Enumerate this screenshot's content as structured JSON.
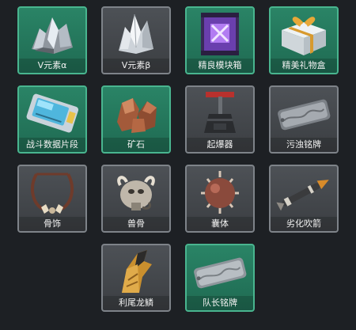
{
  "items": [
    {
      "label": "V元素α",
      "rarity": "green",
      "icon": "crystal-ore-icon"
    },
    {
      "label": "V元素β",
      "rarity": "gray",
      "icon": "white-crystal-icon"
    },
    {
      "label": "精良模块箱",
      "rarity": "green",
      "icon": "module-box-icon"
    },
    {
      "label": "精美礼物盒",
      "rarity": "green",
      "icon": "gift-box-icon"
    },
    {
      "label": "战斗数据片段",
      "rarity": "green",
      "icon": "data-chip-icon"
    },
    {
      "label": "矿石",
      "rarity": "green",
      "icon": "ore-icon"
    },
    {
      "label": "起爆器",
      "rarity": "gray",
      "icon": "detonator-icon"
    },
    {
      "label": "污浊铭牌",
      "rarity": "gray",
      "icon": "dirty-nameplate-icon"
    },
    {
      "label": "骨饰",
      "rarity": "gray",
      "icon": "bone-necklace-icon"
    },
    {
      "label": "兽骨",
      "rarity": "gray",
      "icon": "beast-bone-icon"
    },
    {
      "label": "囊体",
      "rarity": "gray",
      "icon": "spiked-sac-icon"
    },
    {
      "label": "劣化吹箭",
      "rarity": "gray",
      "icon": "blowgun-dart-icon"
    },
    {
      "label": "利尾龙鳞",
      "rarity": "gray",
      "icon": "dragon-scale-icon"
    },
    {
      "label": "队长铭牌",
      "rarity": "green",
      "icon": "captain-nameplate-icon"
    }
  ]
}
